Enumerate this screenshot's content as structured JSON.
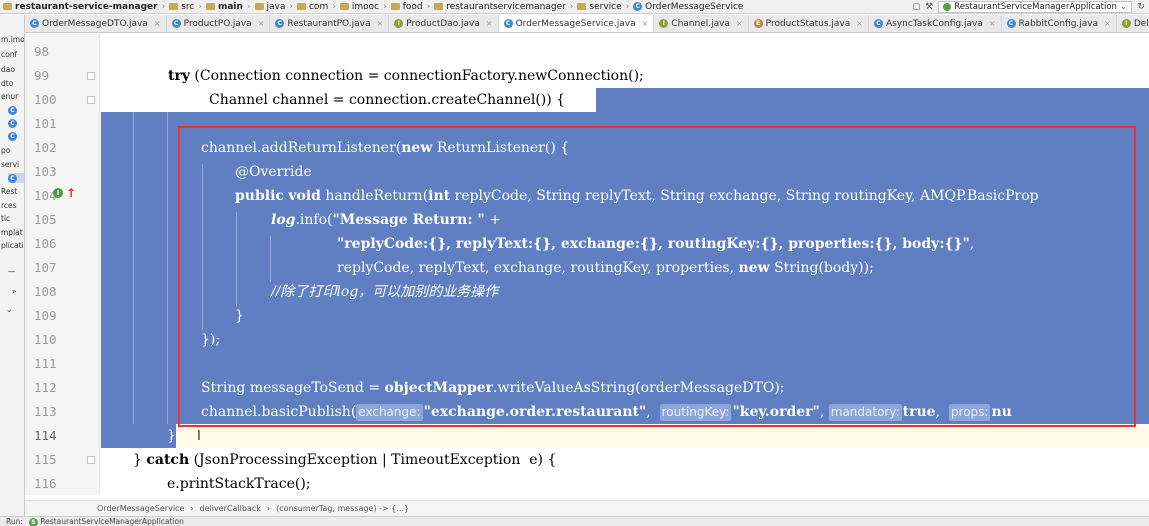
{
  "navbar": {
    "crumbs": [
      {
        "name": "crumb-project",
        "label": "restaurant-service-manager"
      },
      {
        "name": "crumb-src",
        "label": "src"
      },
      {
        "name": "crumb-main",
        "label": "main"
      },
      {
        "name": "crumb-java",
        "label": "java"
      },
      {
        "name": "crumb-com",
        "label": "com"
      },
      {
        "name": "crumb-imooc",
        "label": "imooc"
      },
      {
        "name": "crumb-food",
        "label": "food"
      },
      {
        "name": "crumb-restaurantservicemanager",
        "label": "restaurantservicemanager"
      },
      {
        "name": "crumb-service",
        "label": "service"
      },
      {
        "name": "crumb-file",
        "label": "OrderMessageService"
      }
    ],
    "run_config": "RestaurantServiceManagerApplication"
  },
  "tabs": [
    {
      "label": "OrderMessageDTO.java",
      "icon": "c"
    },
    {
      "label": "ProductPO.java",
      "icon": "c"
    },
    {
      "label": "RestaurantPO.java",
      "icon": "c"
    },
    {
      "label": "ProductDao.java",
      "icon": "i"
    },
    {
      "label": "OrderMessageService.java",
      "icon": "c",
      "active": true
    },
    {
      "label": "Channel.java",
      "icon": "i"
    },
    {
      "label": "ProductStatus.java",
      "icon": "e"
    },
    {
      "label": "AsyncTaskConfig.java",
      "icon": "c"
    },
    {
      "label": "RabbitConfig.java",
      "icon": "c"
    },
    {
      "label": "DeliverCallback.java",
      "icon": "i"
    }
  ],
  "project_tree": [
    "m.imo",
    "conf",
    "dao",
    "dto",
    "enur",
    "C",
    "P",
    "R",
    "po",
    "servi",
    "C",
    "Rest",
    "rces",
    "tic",
    "mplat",
    "plicati"
  ],
  "editor": {
    "line_numbers": [
      "98",
      "99",
      "100",
      "101",
      "102",
      "103",
      "104",
      "105",
      "106",
      "107",
      "108",
      "109",
      "110",
      "111",
      "112",
      "113",
      "114",
      "115",
      "116"
    ],
    "code": {
      "l99_kw": "try",
      "l99_rest": " (Connection connection = connectionFactory.newConnection();",
      "l100": "Channel channel = connection.createChannel()) {",
      "l102_a": "channel.addReturnListener(",
      "l102_kw": "new",
      "l102_b": " ReturnListener() {",
      "l103": "@Override",
      "l104_kw1": "public",
      "l104_kw2": "void",
      "l104_a": " handleReturn(",
      "l104_kw3": "int",
      "l104_b": " replyCode, String replyText, String exchange, String routingKey, AMQP.BasicProp",
      "l105_log": "log",
      "l105_a": ".info(",
      "l105_str": "\"Message Return: \"",
      "l105_b": " +",
      "l106_str": "\"replyCode:{}, replyText:{}, exchange:{}, routingKey:{}, properties:{}, body:{}\"",
      "l106_b": ",",
      "l107_a": "replyCode, replyText, exchange, routingKey, properties, ",
      "l107_kw": "new",
      "l107_b": " String(body));",
      "l108": "//除了打印log，可以加别的业务操作",
      "l109": "}",
      "l110": "});",
      "l112_a": "String messageToSend = ",
      "l112_kw": "objectMapper",
      "l112_b": ".writeValueAsString(orderMessageDTO);",
      "l113_a": "channel.basicPublish(",
      "l113_hint1": "exchange:",
      "l113_str1": "\"exchange.order.restaurant\"",
      "l113_c1": ",  ",
      "l113_hint2": "routingKey:",
      "l113_str2": "\"key.order\"",
      "l113_c2": ", ",
      "l113_hint3": "mandatory:",
      "l113_true": "true",
      "l113_c3": ",  ",
      "l113_hint4": "props:",
      "l113_tail": "nu",
      "l114": "}",
      "l115_a": "} ",
      "l115_kw": "catch",
      "l115_b": " (JsonProcessingException | TimeoutException  e) {",
      "l116": "e.printStackTrace();"
    }
  },
  "breadcrumb_bar": [
    "OrderMessageService",
    "deliverCallback",
    "(consumerTag, message) -> {...}"
  ],
  "statusbar": {
    "run_label": "Run:",
    "run_tab": "RestaurantServiceManagerApplication"
  },
  "colors": {
    "selection": "#5f7fc2",
    "highlight_border": "#e8313a",
    "current_line": "#fffae3"
  }
}
